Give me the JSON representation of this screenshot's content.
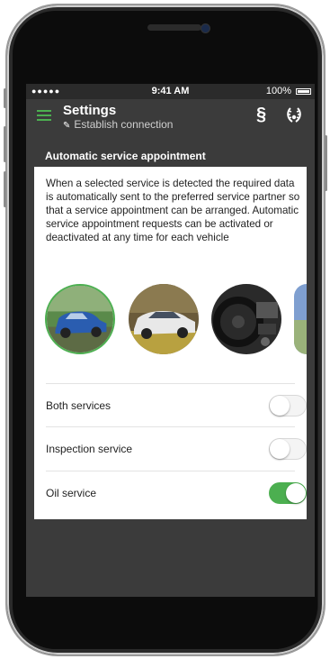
{
  "status_bar": {
    "signal": "●●●●●",
    "time": "9:41 AM",
    "battery": "100%"
  },
  "header": {
    "title": "Settings",
    "subtitle": "Establish connection",
    "paragraph_icon": "§",
    "laurel_icon": "laurel-icon"
  },
  "section": {
    "title": "Automatic service appointment",
    "description": "When a selected service is detected the required data is automatically sent to the preferred service partner so that a service appointment can be arranged. Automatic service appointment requests can be activated or deactivated at any time for each vehicle"
  },
  "vehicles": [
    {
      "name": "vehicle-blue-hatchback",
      "selected": true
    },
    {
      "name": "vehicle-silver-sedan",
      "selected": false
    },
    {
      "name": "vehicle-interior",
      "selected": false
    },
    {
      "name": "vehicle-partial",
      "selected": false
    }
  ],
  "services": [
    {
      "label": "Both services",
      "enabled": false
    },
    {
      "label": "Inspection service",
      "enabled": false
    },
    {
      "label": "Oil service",
      "enabled": true
    }
  ],
  "colors": {
    "accent": "#4caf50",
    "background": "#3b3b3b",
    "card": "#ffffff"
  }
}
